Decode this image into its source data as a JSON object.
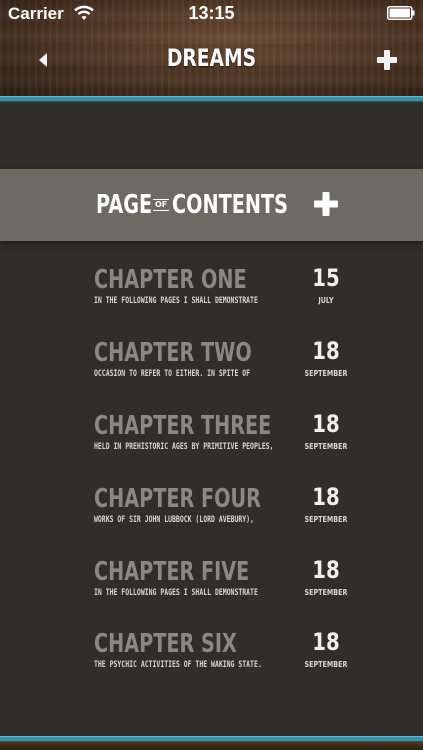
{
  "status_bar": {
    "carrier": "Carrier",
    "time": "13:15",
    "wifi_icon": "wifi-icon",
    "battery_icon": "battery-icon"
  },
  "navbar": {
    "title": "DREAMS",
    "back_icon": "triangle-left-icon",
    "add_icon": "plus-icon"
  },
  "banner": {
    "word1": "PAGE",
    "of": "OF",
    "word2": "CONTENTS",
    "add_icon": "plus-icon"
  },
  "chapters": [
    {
      "title": "CHAPTER ONE",
      "desc": "IN THE FOLLOWING PAGES I SHALL DEMONSTRATE",
      "day": "15",
      "month": "JULY"
    },
    {
      "title": "CHAPTER TWO",
      "desc": "OCCASION TO REFER TO EITHER. IN SPITE OF",
      "day": "18",
      "month": "SEPTEMBER"
    },
    {
      "title": "CHAPTER THREE",
      "desc": "HELD IN PREHISTORIC AGES BY PRIMITIVE PEOPLES,",
      "day": "18",
      "month": "SEPTEMBER"
    },
    {
      "title": "CHAPTER FOUR",
      "desc": "WORKS OF SIR JOHN LUBBOCK (LORD AVEBURY),",
      "day": "18",
      "month": "SEPTEMBER"
    },
    {
      "title": "CHAPTER FIVE",
      "desc": "IN THE FOLLOWING PAGES I SHALL DEMONSTRATE",
      "day": "18",
      "month": "SEPTEMBER"
    },
    {
      "title": "CHAPTER SIX",
      "desc": "THE PSYCHIC ACTIVITIES OF THE WAKING STATE.",
      "day": "18",
      "month": "SEPTEMBER"
    }
  ],
  "colors": {
    "accent_teal": "#3d8fa3",
    "banner_gray": "#6d6a64",
    "background": "#2f2e2b",
    "chapter_title": "#8a8883"
  }
}
